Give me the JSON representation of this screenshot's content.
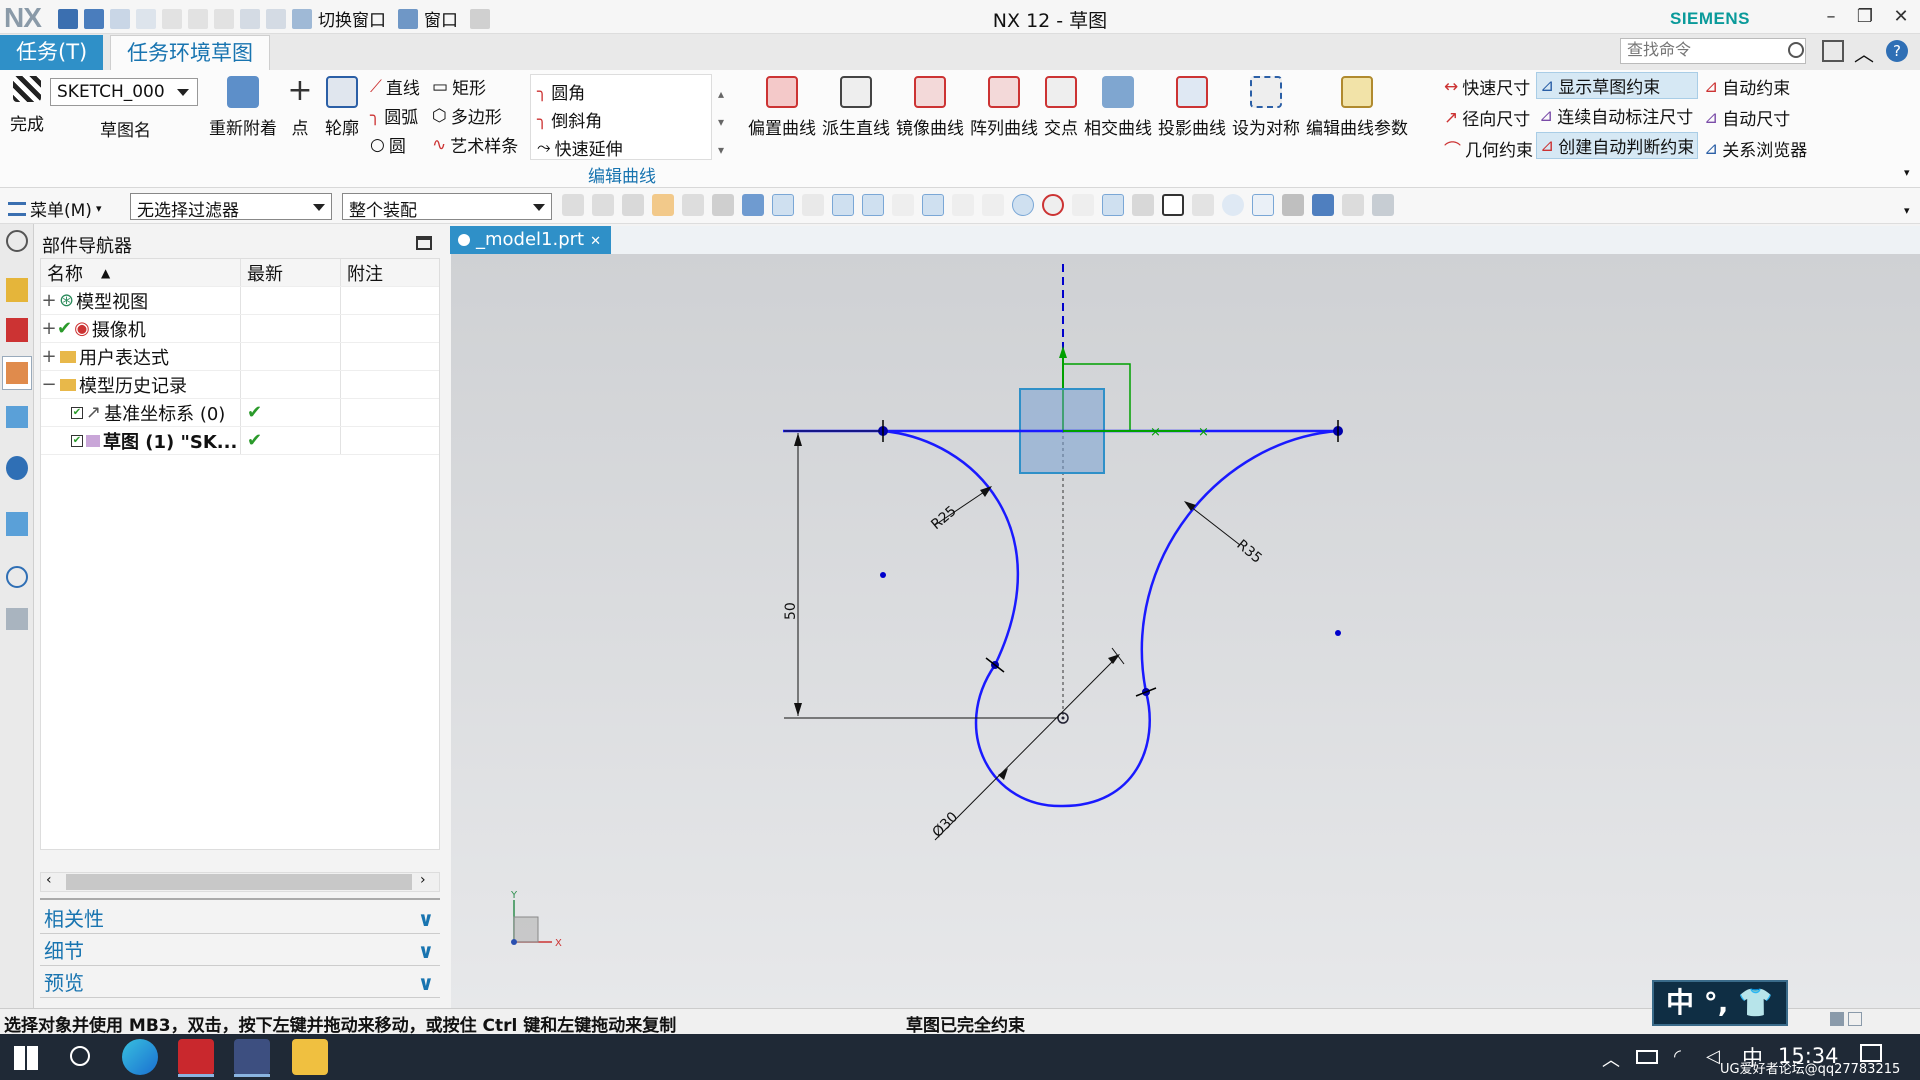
{
  "app": {
    "logo": "NX",
    "title": "NX 12 - 草图",
    "brand": "SIEMENS",
    "window_buttons": [
      "–",
      "❐",
      "✕"
    ]
  },
  "quick_access": {
    "switch_window": "切换窗口",
    "window_menu": "窗口"
  },
  "tabs": [
    {
      "label": "任务(T)"
    },
    {
      "label": "任务环境草图"
    }
  ],
  "command_search": {
    "placeholder": "查找命令"
  },
  "ribbon": {
    "finish": "完成",
    "sketch_name_value": "SKETCH_000",
    "sketch_name_label": "草图名",
    "reattach": "重新附着",
    "point": "点",
    "profile": "轮廓",
    "small_curves": [
      "直线",
      "圆弧",
      "圆",
      "矩形",
      "多边形",
      "艺术样条"
    ],
    "edit_curve": {
      "items": [
        "圆角",
        "倒斜角",
        "快速延伸"
      ],
      "group_label": "编辑曲线"
    },
    "big_buttons": [
      "偏置曲线",
      "派生直线",
      "镜像曲线",
      "阵列曲线",
      "交点",
      "相交曲线",
      "投影曲线",
      "设为对称",
      "编辑曲线参数"
    ],
    "dimensions": [
      "快速尺寸",
      "径向尺寸",
      "几何约束"
    ],
    "constraint_col2": [
      "显示草图约束",
      "连续自动标注尺寸",
      "创建自动判断约束"
    ],
    "constraint_col3": [
      "自动约束",
      "自动尺寸",
      "关系浏览器"
    ]
  },
  "toolbar2": {
    "menu": "菜单(M)",
    "filter": "无选择过滤器",
    "scope": "整个装配"
  },
  "navigator": {
    "title": "部件导航器",
    "columns": [
      "名称",
      "最新",
      "附注"
    ],
    "rows": [
      {
        "expander": "+",
        "label": "模型视图",
        "latest": ""
      },
      {
        "expander": "+",
        "label": "摄像机",
        "latest": ""
      },
      {
        "expander": "+",
        "label": "用户表达式",
        "latest": ""
      },
      {
        "expander": "−",
        "label": "模型历史记录",
        "latest": ""
      },
      {
        "expander": "",
        "label": "基准坐标系 (0)",
        "latest": "✔"
      },
      {
        "expander": "",
        "label": "草图 (1) \"SK...",
        "latest": "✔"
      }
    ],
    "panels": [
      "相关性",
      "细节",
      "预览"
    ]
  },
  "document_tab": {
    "label": "_model1.prt"
  },
  "sketch": {
    "dimensions": {
      "radius_left": "R25",
      "radius_right": "R35",
      "vertical": "50",
      "diameter": "Ø30"
    },
    "triad": {
      "x": "X",
      "y": "Y"
    }
  },
  "status": {
    "prompt": "选择对象并使用 MB3，双击，按下左键并拖动来移动，或按住 Ctrl 键和左键拖动来复制",
    "state": "草图已完全约束"
  },
  "ime": {
    "text": "中 °, 👕"
  },
  "taskbar": {
    "ime_indicator": "中",
    "clock": "15:34",
    "watermark": "UG爱好者论坛@qq27783215"
  },
  "colors": {
    "accent": "#2f90c8",
    "curve": "#0000cc",
    "axis_green": "#00a000"
  }
}
